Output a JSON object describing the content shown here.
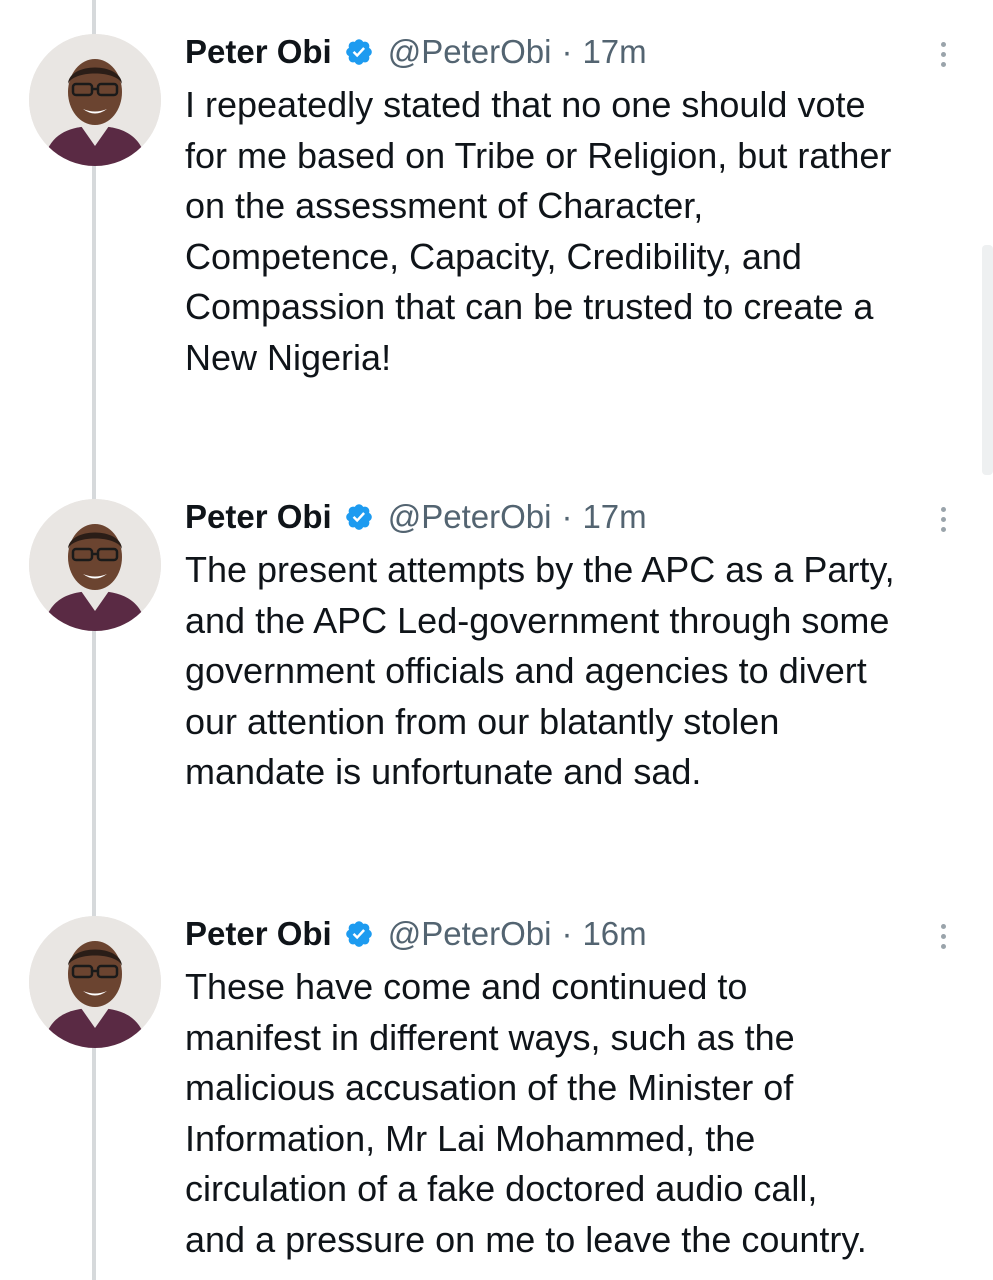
{
  "tweets": [
    {
      "author_name": "Peter Obi",
      "handle": "@PeterObi",
      "separator": "·",
      "time": "17m",
      "text": "I repeatedly stated that no one should vote\nfor me based on Tribe or Religion, but rather\non the assessment of Character,\nCompetence, Capacity, Credibility, and\nCompassion that can be trusted to create a\nNew Nigeria!"
    },
    {
      "author_name": "Peter Obi",
      "handle": "@PeterObi",
      "separator": "·",
      "time": "17m",
      "text": "The present attempts by the APC as a Party,\nand the APC Led-government through some\ngovernment officials and agencies to divert\nour attention from our blatantly stolen\nmandate is unfortunate and sad."
    },
    {
      "author_name": "Peter Obi",
      "handle": "@PeterObi",
      "separator": "·",
      "time": "16m",
      "text": "These have come and continued to\nmanifest in different ways, such as the\nmalicious accusation of the Minister of\nInformation, Mr Lai Mohammed, the\ncirculation of a fake doctored audio call,\nand a pressure on me to leave the country."
    }
  ],
  "icons": {
    "verified": "verified-badge-icon",
    "more": "more-options-icon",
    "avatar": "profile-avatar"
  },
  "colors": {
    "verified_blue": "#1d9bf0",
    "secondary_text": "#536471",
    "primary_text": "#0f1419",
    "thread_line": "#d6d9db"
  }
}
